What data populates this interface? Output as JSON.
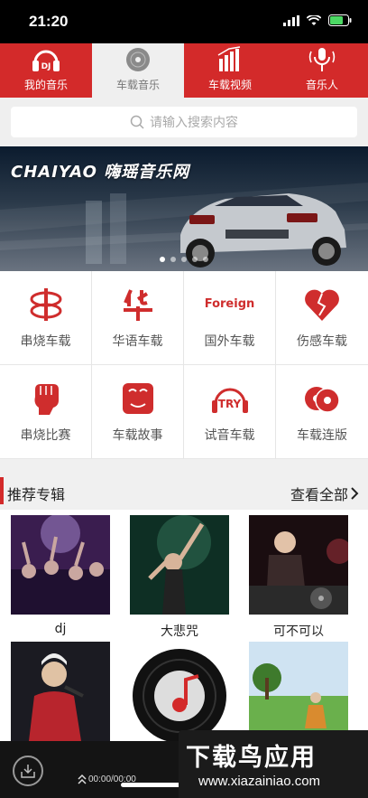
{
  "status": {
    "time": "21:20"
  },
  "tabs": [
    {
      "label": "我的音乐",
      "icon": "dj-headphones-icon"
    },
    {
      "label": "车载音乐",
      "icon": "disc-icon",
      "active": true
    },
    {
      "label": "车载视频",
      "icon": "bar-chart-icon"
    },
    {
      "label": "音乐人",
      "icon": "microphone-icon"
    }
  ],
  "search": {
    "placeholder": "请输入搜索内容"
  },
  "banner": {
    "title": "CHAIYAO 嗨瑶音乐网",
    "dots": 5,
    "active_dot": 0
  },
  "categories": [
    {
      "label": "串烧车载",
      "icon": "chuan-logo-icon"
    },
    {
      "label": "华语车载",
      "icon": "hua-logo-icon"
    },
    {
      "label": "国外车载",
      "icon_text": "Foreign"
    },
    {
      "label": "伤感车载",
      "icon": "broken-heart-icon"
    },
    {
      "label": "串烧比赛",
      "icon": "fist-icon"
    },
    {
      "label": "车载故事",
      "icon": "mask-icon"
    },
    {
      "label": "试音车载",
      "icon_text": "TRY"
    },
    {
      "label": "车载连版",
      "icon": "two-discs-icon"
    }
  ],
  "section": {
    "title": "推荐专辑",
    "more": "查看全部"
  },
  "albums": [
    {
      "name": "dj",
      "icon": "concert-crowd-cover"
    },
    {
      "name": "大悲咒",
      "icon": "dancer-cover"
    },
    {
      "name": "可不可以",
      "icon": "dj-mixer-cover"
    },
    {
      "name": "",
      "icon": "singer-cover"
    },
    {
      "name": "",
      "icon": "music-disc-cover"
    },
    {
      "name": "",
      "icon": "meadow-cover"
    }
  ],
  "player": {
    "time": "00:00/00:00"
  },
  "watermark": {
    "title": "下载鸟应用",
    "url": "www.xiazainiao.com"
  },
  "colors": {
    "accent": "#d32a2a",
    "icon_red": "#cf2d2d"
  }
}
